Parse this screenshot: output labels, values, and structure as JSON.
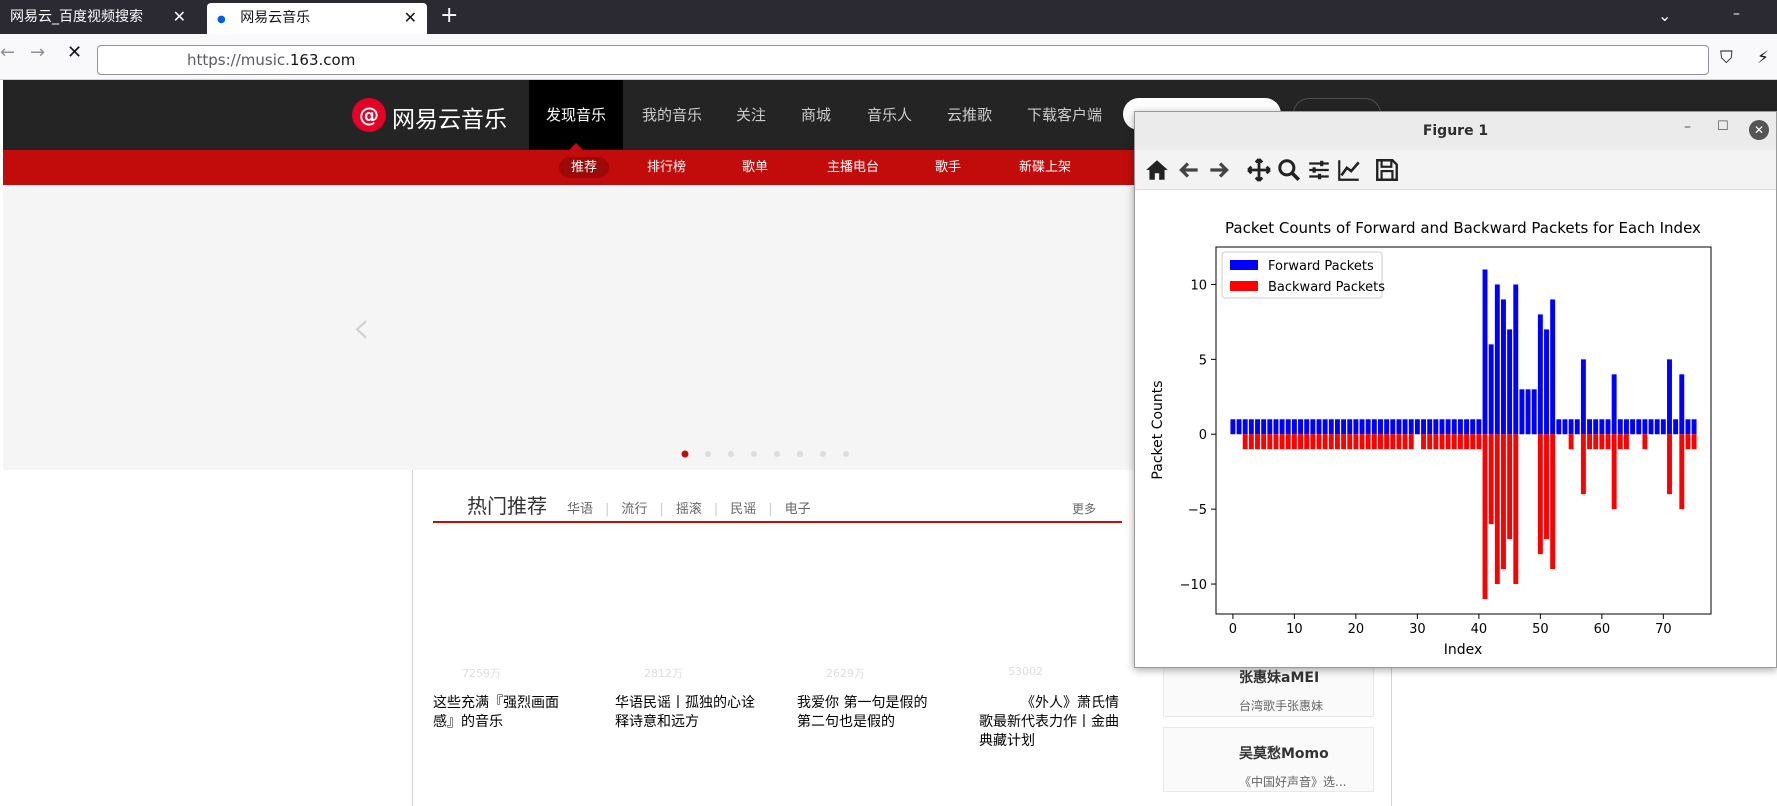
{
  "browser": {
    "tabs": [
      {
        "title": "网易云_百度视频搜索"
      },
      {
        "title": "网易云音乐"
      }
    ],
    "new_tab": "+",
    "url_prefix": "https://music.",
    "url_host": "163.com"
  },
  "site": {
    "logo": "网易云音乐",
    "nav": [
      {
        "label": "发现音乐"
      },
      {
        "label": "我的音乐"
      },
      {
        "label": "关注"
      },
      {
        "label": "商城"
      },
      {
        "label": "音乐人"
      },
      {
        "label": "云推歌"
      },
      {
        "label": "下载客户端"
      }
    ],
    "subnav": [
      {
        "label": "推荐"
      },
      {
        "label": "排行榜"
      },
      {
        "label": "歌单"
      },
      {
        "label": "主播电台"
      },
      {
        "label": "歌手"
      },
      {
        "label": "新碟上架"
      }
    ],
    "hot": {
      "title": "热门推荐",
      "tags": [
        "华语",
        "流行",
        "摇滚",
        "民谣",
        "电子"
      ],
      "more": "更多",
      "playlists": [
        {
          "count": "7259万",
          "name_line1": "这些充满『强烈画面",
          "name_line2": "感』的音乐"
        },
        {
          "count": "2812万",
          "name_line1": "华语民谣丨孤独的心诠",
          "name_line2": "释诗意和远方"
        },
        {
          "count": "2629万",
          "name_line1": "我爱你 第一句是假的",
          "name_line2": "第二句也是假的"
        },
        {
          "count": "53002",
          "name_line1": "《外人》萧氏情",
          "name_line2": "歌最新代表力作丨金曲",
          "name_line3": "典藏计划"
        }
      ]
    },
    "artists": [
      {
        "name": "张惠妹aMEI",
        "desc": "台湾歌手张惠妹"
      },
      {
        "name": "吴莫愁Momo",
        "desc": "《中国好声音》选..."
      }
    ]
  },
  "figure": {
    "window_title": "Figure 1",
    "chart_data": {
      "type": "bar",
      "title": "Packet Counts of Forward and Backward Packets for Each Index",
      "xlabel": "Index",
      "ylabel": "Packet Counts",
      "xlim": [
        -2.75,
        77.75
      ],
      "ylim": [
        -12,
        12.5
      ],
      "xticks": [
        0,
        10,
        20,
        30,
        40,
        50,
        60,
        70
      ],
      "yticks": [
        -10,
        -5,
        0,
        5,
        10
      ],
      "legend_position": "upper-left",
      "x": [
        0,
        1,
        2,
        3,
        4,
        5,
        6,
        7,
        8,
        9,
        10,
        11,
        12,
        13,
        14,
        15,
        16,
        17,
        18,
        19,
        20,
        21,
        22,
        23,
        24,
        25,
        26,
        27,
        28,
        29,
        30,
        31,
        32,
        33,
        34,
        35,
        36,
        37,
        38,
        39,
        40,
        41,
        42,
        43,
        44,
        45,
        46,
        47,
        48,
        49,
        50,
        51,
        52,
        53,
        54,
        55,
        56,
        57,
        58,
        59,
        60,
        61,
        62,
        63,
        64,
        65,
        66,
        67,
        68,
        69,
        70,
        71,
        72,
        73,
        74,
        75
      ],
      "series": [
        {
          "name": "Forward Packets",
          "color": "#0000ff",
          "values": [
            1,
            1,
            1,
            1,
            1,
            1,
            1,
            1,
            1,
            1,
            1,
            1,
            1,
            1,
            1,
            1,
            1,
            1,
            1,
            1,
            1,
            1,
            1,
            1,
            1,
            1,
            1,
            1,
            1,
            1,
            1,
            1,
            1,
            1,
            1,
            1,
            1,
            1,
            1,
            1,
            1,
            11,
            6,
            10,
            9,
            7,
            10,
            3,
            3,
            3,
            8,
            7,
            9,
            1,
            1,
            1,
            1,
            5,
            1,
            1,
            1,
            1,
            4,
            1,
            1,
            1,
            1,
            1,
            1,
            1,
            1,
            5,
            1,
            4,
            1,
            1
          ]
        },
        {
          "name": "Backward Packets",
          "color": "#ff0000",
          "values": [
            0,
            0,
            -1,
            -1,
            -1,
            -1,
            -1,
            -1,
            -1,
            -1,
            -1,
            -1,
            -1,
            -1,
            -1,
            -1,
            -1,
            -1,
            -1,
            -1,
            -1,
            -1,
            -1,
            -1,
            -1,
            -1,
            -1,
            -1,
            -1,
            -1,
            0,
            -1,
            -1,
            -1,
            -1,
            -1,
            -1,
            -1,
            -1,
            -1,
            -1,
            -11,
            -6,
            -10,
            -9,
            -7,
            -10,
            0,
            0,
            0,
            -8,
            -7,
            -9,
            0,
            0,
            -1,
            0,
            -4,
            -1,
            -1,
            -1,
            -1,
            -5,
            -1,
            -1,
            0,
            0,
            -1,
            0,
            0,
            0,
            -4,
            0,
            -5,
            -1,
            -1
          ]
        }
      ]
    }
  }
}
